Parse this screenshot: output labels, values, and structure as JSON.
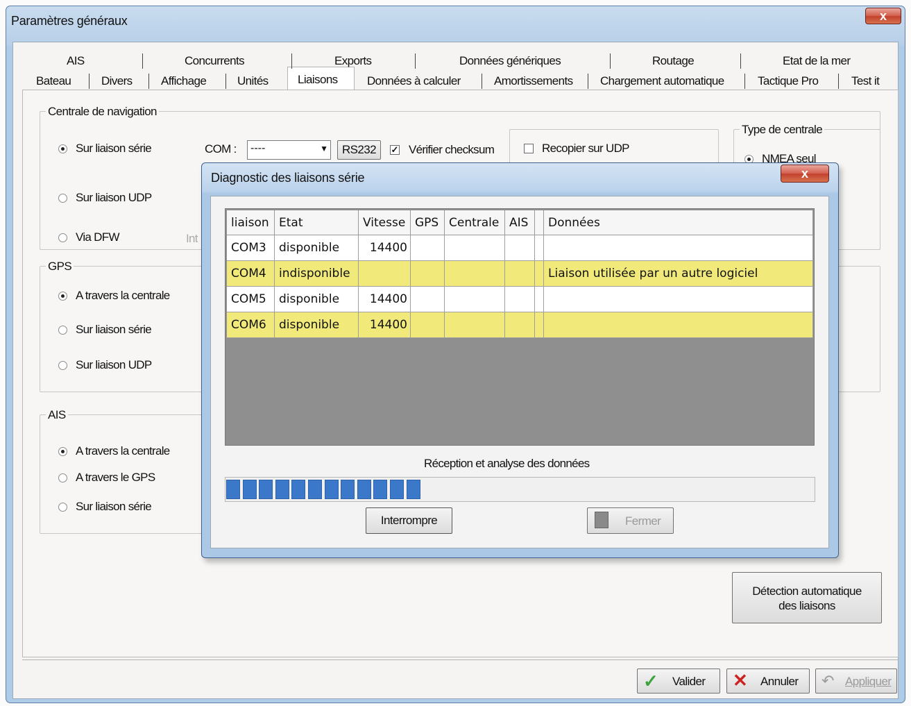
{
  "window": {
    "title": "Paramètres généraux",
    "close_symbol": "x"
  },
  "tabs": {
    "row1": [
      "AIS",
      "Concurrents",
      "Exports",
      "Données génériques",
      "Routage",
      "Etat de la mer"
    ],
    "row2": [
      "Bateau",
      "Divers",
      "Affichage",
      "Unités",
      "Liaisons",
      "Données à calculer",
      "Amortissements",
      "Chargement automatique",
      "Tactique Pro",
      "Test it"
    ],
    "active": "Liaisons"
  },
  "navigation": {
    "title": "Centrale de navigation",
    "radio_serie": "Sur liaison série",
    "radio_udp": "Sur liaison UDP",
    "radio_dfw": "Via DFW",
    "dfw_partial": "Int",
    "com_label": "COM :",
    "com_value": "----",
    "rs232_button": "RS232",
    "verify_checksum": "Vérifier checksum",
    "copy_udp": "Recopier sur UDP"
  },
  "centrale_type": {
    "title": "Type de centrale",
    "option_partial": "NMEA seul"
  },
  "gps": {
    "title": "GPS",
    "radio_centrale": "A travers la centrale",
    "radio_serie": "Sur liaison série",
    "radio_udp": "Sur liaison UDP"
  },
  "ais": {
    "title": "AIS",
    "radio_centrale": "A travers la centrale",
    "radio_gps": "A travers le GPS",
    "radio_serie": "Sur liaison série"
  },
  "auto_detect": {
    "line1": "Détection automatique",
    "line2": "des liaisons"
  },
  "footer": {
    "ok": "Valider",
    "cancel": "Annuler",
    "apply": "Appliquer",
    "ok_icon": "check-icon",
    "cancel_icon": "cross-icon",
    "apply_icon": "undo-icon",
    "ok_color": "#3da33d",
    "cancel_color": "#cc2222"
  },
  "dialog": {
    "title": "Diagnostic des liaisons série",
    "close_symbol": "x",
    "columns": [
      "liaison",
      "Etat",
      "Vitesse",
      "GPS",
      "Centrale",
      "AIS",
      "",
      "Données"
    ],
    "rows": [
      {
        "liaison": "COM3",
        "etat": "disponible",
        "vitesse": "14400",
        "gps": "",
        "centrale": "",
        "ais": "",
        "donnees": "",
        "highlight": false
      },
      {
        "liaison": "COM4",
        "etat": "indisponible",
        "vitesse": "",
        "gps": "",
        "centrale": "",
        "ais": "",
        "donnees": "Liaison utilisée par un autre logiciel",
        "highlight": true
      },
      {
        "liaison": "COM5",
        "etat": "disponible",
        "vitesse": "14400",
        "gps": "",
        "centrale": "",
        "ais": "",
        "donnees": "",
        "highlight": false
      },
      {
        "liaison": "COM6",
        "etat": "disponible",
        "vitesse": "14400",
        "gps": "",
        "centrale": "",
        "ais": "",
        "donnees": "",
        "highlight": true
      }
    ],
    "highlight_color": "#f1ea7b",
    "progress_label": "Réception et analyse des données",
    "progress_fraction": 0.36,
    "progress_color": "#3b78c9",
    "interrupt_button": "Interrompre",
    "close_button": "Fermer",
    "close_button_icon": "door-icon"
  }
}
